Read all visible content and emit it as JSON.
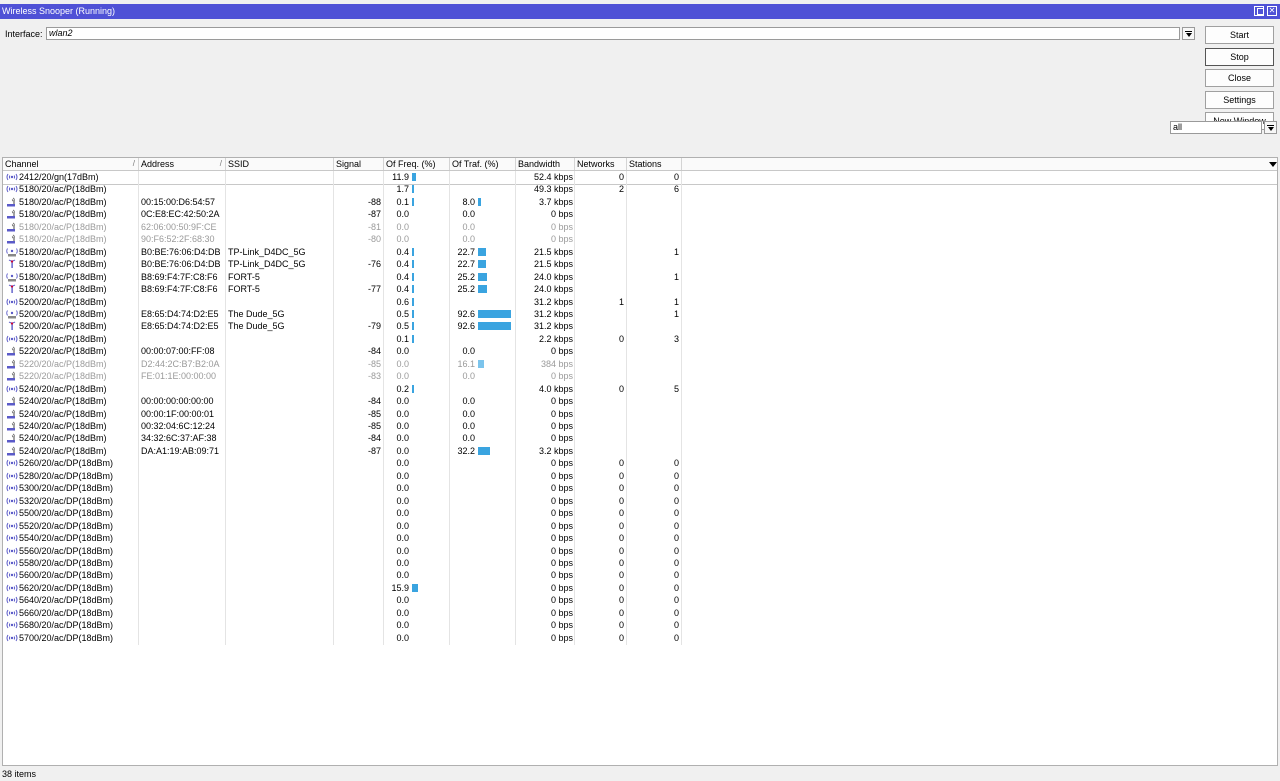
{
  "window": {
    "title": "Wireless Snooper (Running)"
  },
  "interface": {
    "label": "Interface:",
    "value": "wlan2"
  },
  "buttons": {
    "start": "Start",
    "stop": "Stop",
    "close": "Close",
    "settings": "Settings",
    "new_window": "New Window"
  },
  "filter": {
    "value": "all"
  },
  "columns": [
    "Channel",
    "Address",
    "SSID",
    "Signal",
    "Of Freq. (%)",
    "Of Traf. (%)",
    "Bandwidth",
    "Networks",
    "Stations"
  ],
  "rows": [
    {
      "icon": "channel",
      "channel": "2412/20/gn(17dBm)",
      "address": "",
      "ssid": "",
      "signal": "",
      "freq": "11.9",
      "traf": "",
      "bandwidth": "52.4 kbps",
      "networks": "0",
      "stations": "0",
      "grey": false
    },
    {
      "icon": "channel",
      "channel": "5180/20/ac/P(18dBm)",
      "address": "",
      "ssid": "",
      "signal": "",
      "freq": "1.7",
      "traf": "",
      "bandwidth": "49.3 kbps",
      "networks": "2",
      "stations": "6",
      "grey": false
    },
    {
      "icon": "station",
      "channel": "5180/20/ac/P(18dBm)",
      "address": "00:15:00:D6:54:57",
      "ssid": "",
      "signal": "-88",
      "freq": "0.1",
      "traf": "8.0",
      "bandwidth": "3.7 kbps",
      "networks": "",
      "stations": "",
      "grey": false
    },
    {
      "icon": "station",
      "channel": "5180/20/ac/P(18dBm)",
      "address": "0C:E8:EC:42:50:2A",
      "ssid": "",
      "signal": "-87",
      "freq": "0.0",
      "traf": "0.0",
      "bandwidth": "0 bps",
      "networks": "",
      "stations": "",
      "grey": false
    },
    {
      "icon": "station",
      "channel": "5180/20/ac/P(18dBm)",
      "address": "62:06:00:50:9F:CE",
      "ssid": "",
      "signal": "-81",
      "freq": "0.0",
      "traf": "0.0",
      "bandwidth": "0 bps",
      "networks": "",
      "stations": "",
      "grey": true
    },
    {
      "icon": "station",
      "channel": "5180/20/ac/P(18dBm)",
      "address": "90:F6:52:2F:68:30",
      "ssid": "",
      "signal": "-80",
      "freq": "0.0",
      "traf": "0.0",
      "bandwidth": "0 bps",
      "networks": "",
      "stations": "",
      "grey": true
    },
    {
      "icon": "network",
      "channel": "5180/20/ac/P(18dBm)",
      "address": "B0:BE:76:06:D4:DB",
      "ssid": "TP-Link_D4DC_5G",
      "signal": "",
      "freq": "0.4",
      "traf": "22.7",
      "bandwidth": "21.5 kbps",
      "networks": "",
      "stations": "1",
      "grey": false
    },
    {
      "icon": "ap",
      "channel": "5180/20/ac/P(18dBm)",
      "address": "B0:BE:76:06:D4:DB",
      "ssid": "TP-Link_D4DC_5G",
      "signal": "-76",
      "freq": "0.4",
      "traf": "22.7",
      "bandwidth": "21.5 kbps",
      "networks": "",
      "stations": "",
      "grey": false
    },
    {
      "icon": "network",
      "channel": "5180/20/ac/P(18dBm)",
      "address": "B8:69:F4:7F:C8:F6",
      "ssid": "FORT-5",
      "signal": "",
      "freq": "0.4",
      "traf": "25.2",
      "bandwidth": "24.0 kbps",
      "networks": "",
      "stations": "1",
      "grey": false
    },
    {
      "icon": "ap",
      "channel": "5180/20/ac/P(18dBm)",
      "address": "B8:69:F4:7F:C8:F6",
      "ssid": "FORT-5",
      "signal": "-77",
      "freq": "0.4",
      "traf": "25.2",
      "bandwidth": "24.0 kbps",
      "networks": "",
      "stations": "",
      "grey": false
    },
    {
      "icon": "channel",
      "channel": "5200/20/ac/P(18dBm)",
      "address": "",
      "ssid": "",
      "signal": "",
      "freq": "0.6",
      "traf": "",
      "bandwidth": "31.2 kbps",
      "networks": "1",
      "stations": "1",
      "grey": false
    },
    {
      "icon": "network",
      "channel": "5200/20/ac/P(18dBm)",
      "address": "E8:65:D4:74:D2:E5",
      "ssid": "The Dude_5G",
      "signal": "",
      "freq": "0.5",
      "traf": "92.6",
      "bandwidth": "31.2 kbps",
      "networks": "",
      "stations": "1",
      "grey": false
    },
    {
      "icon": "ap",
      "channel": "5200/20/ac/P(18dBm)",
      "address": "E8:65:D4:74:D2:E5",
      "ssid": "The Dude_5G",
      "signal": "-79",
      "freq": "0.5",
      "traf": "92.6",
      "bandwidth": "31.2 kbps",
      "networks": "",
      "stations": "",
      "grey": false
    },
    {
      "icon": "channel",
      "channel": "5220/20/ac/P(18dBm)",
      "address": "",
      "ssid": "",
      "signal": "",
      "freq": "0.1",
      "traf": "",
      "bandwidth": "2.2 kbps",
      "networks": "0",
      "stations": "3",
      "grey": false
    },
    {
      "icon": "station",
      "channel": "5220/20/ac/P(18dBm)",
      "address": "00:00:07:00:FF:08",
      "ssid": "",
      "signal": "-84",
      "freq": "0.0",
      "traf": "0.0",
      "bandwidth": "0 bps",
      "networks": "",
      "stations": "",
      "grey": false
    },
    {
      "icon": "station",
      "channel": "5220/20/ac/P(18dBm)",
      "address": "D2:44:2C:B7:B2:0A",
      "ssid": "",
      "signal": "-85",
      "freq": "0.0",
      "traf": "16.1",
      "bandwidth": "384 bps",
      "networks": "",
      "stations": "",
      "grey": true
    },
    {
      "icon": "station",
      "channel": "5220/20/ac/P(18dBm)",
      "address": "FE:01:1E:00:00:00",
      "ssid": "",
      "signal": "-83",
      "freq": "0.0",
      "traf": "0.0",
      "bandwidth": "0 bps",
      "networks": "",
      "stations": "",
      "grey": true
    },
    {
      "icon": "channel",
      "channel": "5240/20/ac/P(18dBm)",
      "address": "",
      "ssid": "",
      "signal": "",
      "freq": "0.2",
      "traf": "",
      "bandwidth": "4.0 kbps",
      "networks": "0",
      "stations": "5",
      "grey": false
    },
    {
      "icon": "station",
      "channel": "5240/20/ac/P(18dBm)",
      "address": "00:00:00:00:00:00",
      "ssid": "",
      "signal": "-84",
      "freq": "0.0",
      "traf": "0.0",
      "bandwidth": "0 bps",
      "networks": "",
      "stations": "",
      "grey": false
    },
    {
      "icon": "station",
      "channel": "5240/20/ac/P(18dBm)",
      "address": "00:00:1F:00:00:01",
      "ssid": "",
      "signal": "-85",
      "freq": "0.0",
      "traf": "0.0",
      "bandwidth": "0 bps",
      "networks": "",
      "stations": "",
      "grey": false
    },
    {
      "icon": "station",
      "channel": "5240/20/ac/P(18dBm)",
      "address": "00:32:04:6C:12:24",
      "ssid": "",
      "signal": "-85",
      "freq": "0.0",
      "traf": "0.0",
      "bandwidth": "0 bps",
      "networks": "",
      "stations": "",
      "grey": false
    },
    {
      "icon": "station",
      "channel": "5240/20/ac/P(18dBm)",
      "address": "34:32:6C:37:AF:38",
      "ssid": "",
      "signal": "-84",
      "freq": "0.0",
      "traf": "0.0",
      "bandwidth": "0 bps",
      "networks": "",
      "stations": "",
      "grey": false
    },
    {
      "icon": "station",
      "channel": "5240/20/ac/P(18dBm)",
      "address": "DA:A1:19:AB:09:71",
      "ssid": "",
      "signal": "-87",
      "freq": "0.0",
      "traf": "32.2",
      "bandwidth": "3.2 kbps",
      "networks": "",
      "stations": "",
      "grey": false
    },
    {
      "icon": "channel",
      "channel": "5260/20/ac/DP(18dBm)",
      "address": "",
      "ssid": "",
      "signal": "",
      "freq": "0.0",
      "traf": "",
      "bandwidth": "0 bps",
      "networks": "0",
      "stations": "0",
      "grey": false
    },
    {
      "icon": "channel",
      "channel": "5280/20/ac/DP(18dBm)",
      "address": "",
      "ssid": "",
      "signal": "",
      "freq": "0.0",
      "traf": "",
      "bandwidth": "0 bps",
      "networks": "0",
      "stations": "0",
      "grey": false
    },
    {
      "icon": "channel",
      "channel": "5300/20/ac/DP(18dBm)",
      "address": "",
      "ssid": "",
      "signal": "",
      "freq": "0.0",
      "traf": "",
      "bandwidth": "0 bps",
      "networks": "0",
      "stations": "0",
      "grey": false
    },
    {
      "icon": "channel",
      "channel": "5320/20/ac/DP(18dBm)",
      "address": "",
      "ssid": "",
      "signal": "",
      "freq": "0.0",
      "traf": "",
      "bandwidth": "0 bps",
      "networks": "0",
      "stations": "0",
      "grey": false
    },
    {
      "icon": "channel",
      "channel": "5500/20/ac/DP(18dBm)",
      "address": "",
      "ssid": "",
      "signal": "",
      "freq": "0.0",
      "traf": "",
      "bandwidth": "0 bps",
      "networks": "0",
      "stations": "0",
      "grey": false
    },
    {
      "icon": "channel",
      "channel": "5520/20/ac/DP(18dBm)",
      "address": "",
      "ssid": "",
      "signal": "",
      "freq": "0.0",
      "traf": "",
      "bandwidth": "0 bps",
      "networks": "0",
      "stations": "0",
      "grey": false
    },
    {
      "icon": "channel",
      "channel": "5540/20/ac/DP(18dBm)",
      "address": "",
      "ssid": "",
      "signal": "",
      "freq": "0.0",
      "traf": "",
      "bandwidth": "0 bps",
      "networks": "0",
      "stations": "0",
      "grey": false
    },
    {
      "icon": "channel",
      "channel": "5560/20/ac/DP(18dBm)",
      "address": "",
      "ssid": "",
      "signal": "",
      "freq": "0.0",
      "traf": "",
      "bandwidth": "0 bps",
      "networks": "0",
      "stations": "0",
      "grey": false
    },
    {
      "icon": "channel",
      "channel": "5580/20/ac/DP(18dBm)",
      "address": "",
      "ssid": "",
      "signal": "",
      "freq": "0.0",
      "traf": "",
      "bandwidth": "0 bps",
      "networks": "0",
      "stations": "0",
      "grey": false
    },
    {
      "icon": "channel",
      "channel": "5600/20/ac/DP(18dBm)",
      "address": "",
      "ssid": "",
      "signal": "",
      "freq": "0.0",
      "traf": "",
      "bandwidth": "0 bps",
      "networks": "0",
      "stations": "0",
      "grey": false
    },
    {
      "icon": "channel",
      "channel": "5620/20/ac/DP(18dBm)",
      "address": "",
      "ssid": "",
      "signal": "",
      "freq": "15.9",
      "traf": "",
      "bandwidth": "0 bps",
      "networks": "0",
      "stations": "0",
      "grey": false
    },
    {
      "icon": "channel",
      "channel": "5640/20/ac/DP(18dBm)",
      "address": "",
      "ssid": "",
      "signal": "",
      "freq": "0.0",
      "traf": "",
      "bandwidth": "0 bps",
      "networks": "0",
      "stations": "0",
      "grey": false
    },
    {
      "icon": "channel",
      "channel": "5660/20/ac/DP(18dBm)",
      "address": "",
      "ssid": "",
      "signal": "",
      "freq": "0.0",
      "traf": "",
      "bandwidth": "0 bps",
      "networks": "0",
      "stations": "0",
      "grey": false
    },
    {
      "icon": "channel",
      "channel": "5680/20/ac/DP(18dBm)",
      "address": "",
      "ssid": "",
      "signal": "",
      "freq": "0.0",
      "traf": "",
      "bandwidth": "0 bps",
      "networks": "0",
      "stations": "0",
      "grey": false
    },
    {
      "icon": "channel",
      "channel": "5700/20/ac/DP(18dBm)",
      "address": "",
      "ssid": "",
      "signal": "",
      "freq": "0.0",
      "traf": "",
      "bandwidth": "0 bps",
      "networks": "0",
      "stations": "0",
      "grey": false
    }
  ],
  "status": {
    "items": "38 items"
  },
  "colors": {
    "titlebar": "#4f51d6",
    "bar": "#3aa4e0"
  }
}
